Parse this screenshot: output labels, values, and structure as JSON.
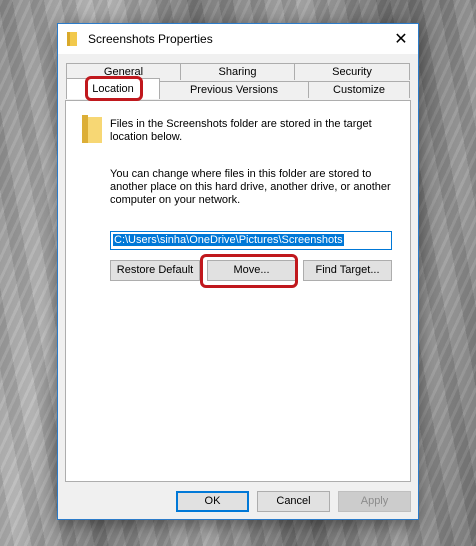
{
  "window": {
    "title": "Screenshots Properties",
    "close_label": "✕"
  },
  "tabs": {
    "row1": [
      "General",
      "Sharing",
      "Security"
    ],
    "row2": [
      "Location",
      "Previous Versions",
      "Customize"
    ],
    "active": "Location"
  },
  "location": {
    "description1": "Files in the Screenshots folder are stored in the target location below.",
    "description2": "You can change where files in this folder are stored to another place on this hard drive, another drive, or another computer on your network.",
    "path_value": "C:\\Users\\sinha\\OneDrive\\Pictures\\Screenshots",
    "buttons": {
      "restore_default": "Restore Default",
      "move": "Move...",
      "find_target": "Find Target..."
    }
  },
  "footer": {
    "ok": "OK",
    "cancel": "Cancel",
    "apply": "Apply"
  },
  "colors": {
    "accent": "#0078d7",
    "highlight": "#c0181d",
    "folder": "#f2c94c"
  },
  "icons": {
    "title": "folder-icon",
    "content": "folder-icon",
    "close": "close-icon"
  }
}
